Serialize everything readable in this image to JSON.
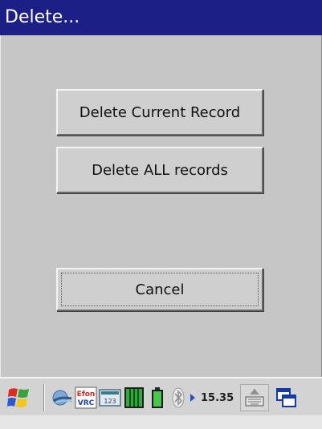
{
  "window": {
    "title": "Delete..."
  },
  "dialog": {
    "buttons": {
      "delete_current": "Delete Current Record",
      "delete_all": "Delete ALL records",
      "cancel": "Cancel"
    }
  },
  "taskbar": {
    "clock": "15.35",
    "icons": [
      "windows-start-icon",
      "network-icon",
      "efon-vrc-icon",
      "input-123-icon",
      "green-grid-icon",
      "battery-icon",
      "bluetooth-icon",
      "tray-arrow-icon",
      "keyboard-icon",
      "switch-windows-icon"
    ],
    "efon_label_top": "Efon",
    "efon_label_bottom": "VRC",
    "input_label": "123"
  },
  "colors": {
    "title_bar": "#1b1f86",
    "dialog_bg": "#c6c6c6",
    "button_face": "#cfcfcf",
    "text": "#111111"
  }
}
